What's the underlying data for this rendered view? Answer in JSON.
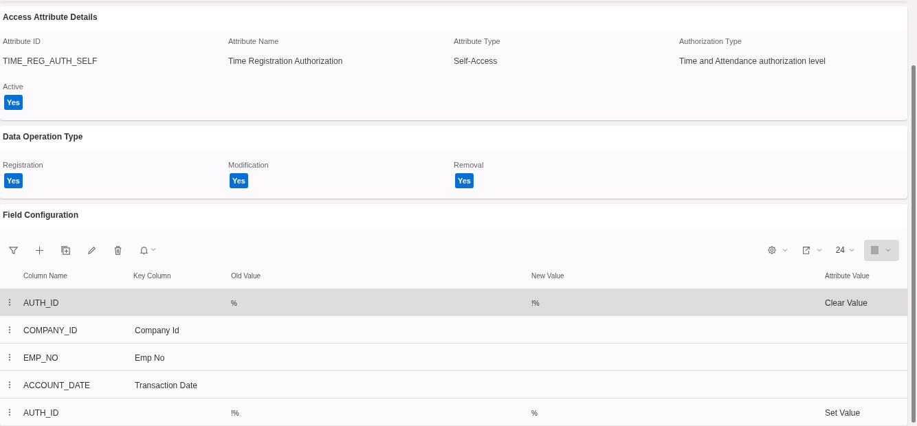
{
  "attribute_details": {
    "title": "Access Attribute Details",
    "fields": [
      {
        "label": "Attribute ID",
        "value": "TIME_REG_AUTH_SELF"
      },
      {
        "label": "Attribute Name",
        "value": "Time Registration Authorization"
      },
      {
        "label": "Attribute Type",
        "value": "Self-Access"
      },
      {
        "label": "Authorization Type",
        "value": "Time and Attendance authorization level"
      }
    ],
    "flags": [
      {
        "label": "Active",
        "value": "Yes",
        "on": true
      }
    ]
  },
  "data_operation_type": {
    "title": "Data Operation Type",
    "flags": [
      {
        "label": "Registration",
        "value": "Yes",
        "on": true
      },
      {
        "label": "Modification",
        "value": "Yes",
        "on": true
      },
      {
        "label": "Removal",
        "value": "Yes",
        "on": true
      }
    ]
  },
  "field_configuration": {
    "title": "Field Configuration",
    "page_size": "24",
    "columns": [
      "Column Name",
      "Key Column",
      "Old Value",
      "New Value",
      "Attribute Value"
    ],
    "rows": [
      {
        "selected": true,
        "cells": [
          "AUTH_ID",
          "",
          "%",
          "!%",
          "Clear Value"
        ]
      },
      {
        "selected": false,
        "cells": [
          "COMPANY_ID",
          "Company Id",
          "",
          "",
          ""
        ]
      },
      {
        "selected": false,
        "cells": [
          "EMP_NO",
          "Emp No",
          "",
          "",
          ""
        ]
      },
      {
        "selected": false,
        "cells": [
          "ACCOUNT_DATE",
          "Transaction Date",
          "",
          "",
          ""
        ]
      },
      {
        "selected": false,
        "cells": [
          "AUTH_ID",
          "",
          "!%",
          "%",
          "Set Value"
        ]
      }
    ]
  }
}
